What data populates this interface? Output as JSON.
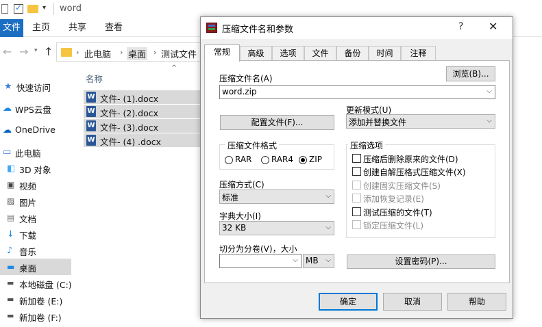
{
  "explorer": {
    "window_title": "word",
    "ribbon_tabs": [
      "文件",
      "主页",
      "共享",
      "查看"
    ],
    "address": [
      "此电脑",
      "桌面",
      "测试文件"
    ],
    "column_name": "名称",
    "sidebar": [
      {
        "label": "快速访问",
        "icon": "star-icon"
      },
      {
        "label": "WPS云盘",
        "icon": "cloud-icon"
      },
      {
        "label": "OneDrive",
        "icon": "onedrive-icon"
      },
      {
        "label": "此电脑",
        "icon": "computer-icon"
      },
      {
        "label": "3D 对象",
        "icon": "cube-icon"
      },
      {
        "label": "视频",
        "icon": "video-icon"
      },
      {
        "label": "图片",
        "icon": "picture-icon"
      },
      {
        "label": "文档",
        "icon": "document-icon"
      },
      {
        "label": "下载",
        "icon": "download-icon"
      },
      {
        "label": "音乐",
        "icon": "music-icon"
      },
      {
        "label": "桌面",
        "icon": "desktop-icon",
        "selected": true
      },
      {
        "label": "本地磁盘 (C:)",
        "icon": "drive-icon"
      },
      {
        "label": "新加卷 (E:)",
        "icon": "drive-icon"
      },
      {
        "label": "新加卷 (F:)",
        "icon": "drive-icon"
      }
    ],
    "files": [
      "文件- (1).docx",
      "文件- (2).docx",
      "文件- (3).docx",
      "文件- (4) .docx"
    ]
  },
  "dialog": {
    "title": "压缩文件名和参数",
    "help": "?",
    "close": "✕",
    "tabs": [
      "常规",
      "高级",
      "选项",
      "文件",
      "备份",
      "时间",
      "注释"
    ],
    "archive_name_label": "压缩文件名(A)",
    "browse_button": "浏览(B)...",
    "archive_name_value": "word.zip",
    "profiles_button": "配置文件(F)...",
    "update_mode_label": "更新模式(U)",
    "update_mode_value": "添加并替换文件",
    "format_group": "压缩文件格式",
    "formats": [
      "RAR",
      "RAR4",
      "ZIP"
    ],
    "format_selected": "ZIP",
    "method_label": "压缩方式(C)",
    "method_value": "标准",
    "dict_label": "字典大小(I)",
    "dict_value": "32 KB",
    "split_label": "切分为分卷(V)，大小",
    "split_value": "",
    "split_unit": "MB",
    "options_group": "压缩选项",
    "options": [
      {
        "label": "压缩后删除原来的文件(D)",
        "enabled": true,
        "checked": false
      },
      {
        "label": "创建自解压格式压缩文件(X)",
        "enabled": true,
        "checked": false
      },
      {
        "label": "创建固实压缩文件(S)",
        "enabled": false,
        "checked": false
      },
      {
        "label": "添加恢复记录(E)",
        "enabled": false,
        "checked": false
      },
      {
        "label": "测试压缩的文件(T)",
        "enabled": true,
        "checked": false
      },
      {
        "label": "锁定压缩文件(L)",
        "enabled": false,
        "checked": false
      }
    ],
    "password_button": "设置密码(P)...",
    "ok_button": "确定",
    "cancel_button": "取消",
    "help_button": "帮助"
  }
}
